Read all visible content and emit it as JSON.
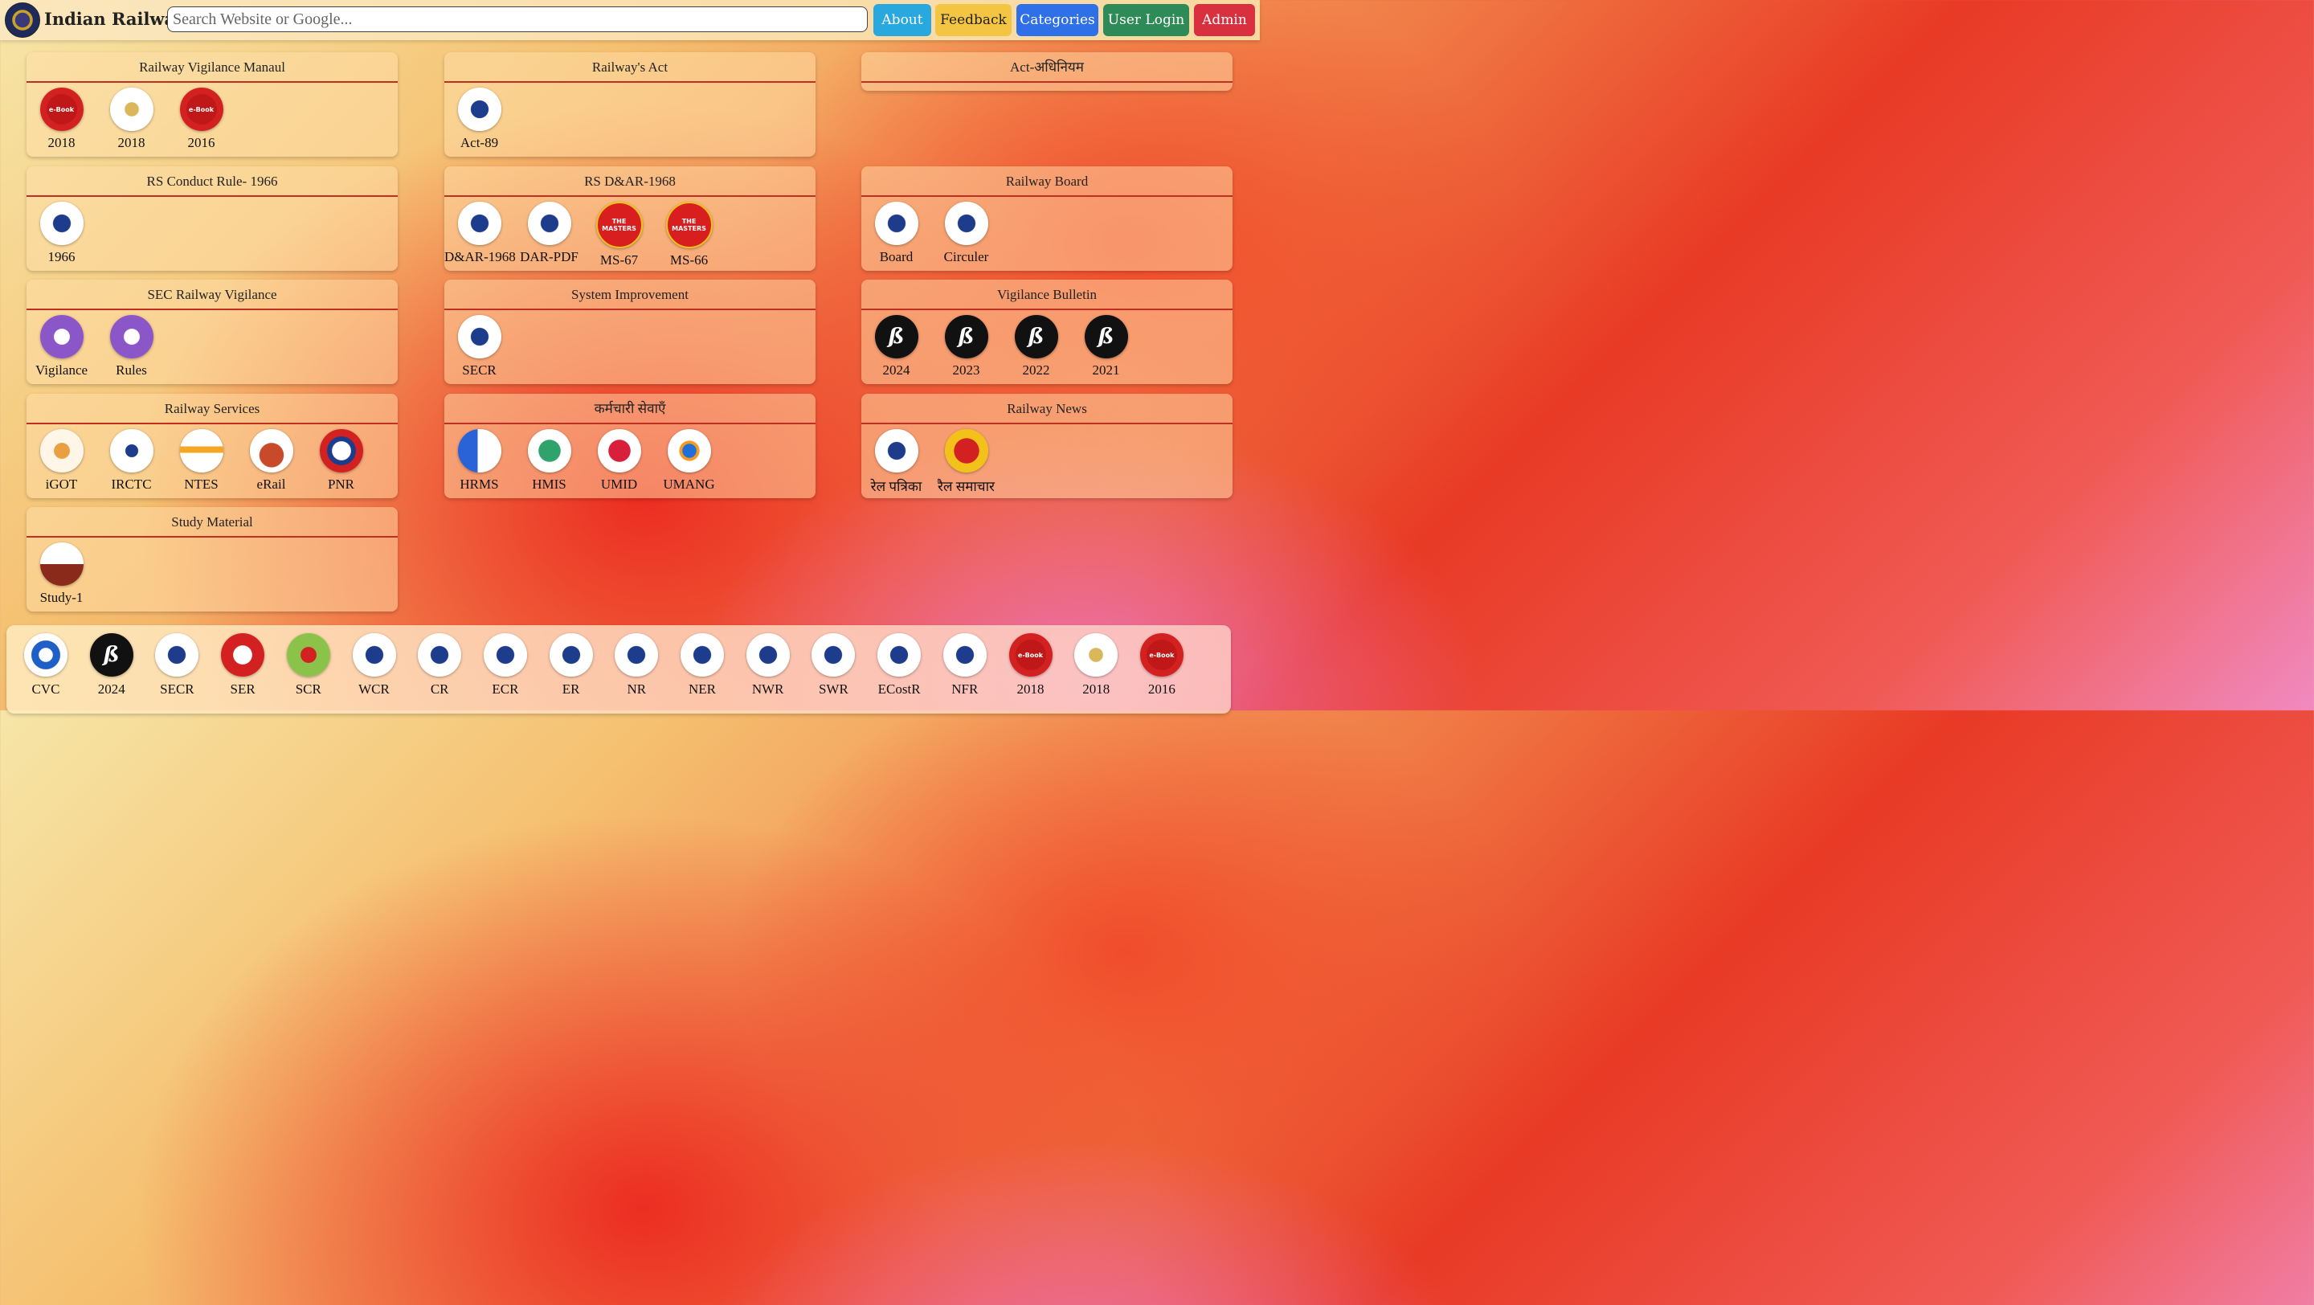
{
  "header": {
    "brand": "Indian Railway",
    "search_placeholder": "Search Website or Google...",
    "buttons": [
      {
        "label": "About",
        "color": "#29a8e0"
      },
      {
        "label": "Feedback",
        "color": "#f4c542"
      },
      {
        "label": "Categories",
        "color": "#2f6fe8"
      },
      {
        "label": "User Login",
        "color": "#2e8b57"
      },
      {
        "label": "Admin",
        "color": "#d9303f"
      }
    ]
  },
  "cards": [
    {
      "title": "Railway Vigilance Manaul",
      "items": [
        {
          "label": "2018",
          "icon": "ebook-icon"
        },
        {
          "label": "2018",
          "icon": "emblem-icon"
        },
        {
          "label": "2016",
          "icon": "ebook-icon"
        }
      ]
    },
    {
      "title": "Railway's Act",
      "items": [
        {
          "label": "Act-89",
          "icon": "act-book-icon"
        }
      ]
    },
    {
      "title": "Act-अधिनियम",
      "items": []
    },
    {
      "title": "RS Conduct Rule- 1966",
      "items": [
        {
          "label": "1966",
          "icon": "conduct-rule-icon"
        }
      ]
    },
    {
      "title": "RS D&AR-1968",
      "items": [
        {
          "label": "D&AR-1968",
          "icon": "dar-book-icon"
        },
        {
          "label": "DAR-PDF",
          "icon": "dar-book-icon"
        },
        {
          "label": "MS-67",
          "icon": "masters-icon"
        },
        {
          "label": "MS-66",
          "icon": "masters-icon"
        }
      ]
    },
    {
      "title": "Railway Board",
      "items": [
        {
          "label": "Board",
          "icon": "ministry-icon"
        },
        {
          "label": "Circuler",
          "icon": "circulars-icon"
        }
      ]
    },
    {
      "title": "SEC Railway Vigilance",
      "items": [
        {
          "label": "Vigilance",
          "icon": "secr-vigilance-icon"
        },
        {
          "label": "Rules",
          "icon": "secr-rules-icon"
        }
      ]
    },
    {
      "title": "System Improvement",
      "items": [
        {
          "label": "SECR",
          "icon": "brain-gears-icon"
        }
      ]
    },
    {
      "title": "Vigilance Bulletin",
      "items": [
        {
          "label": "2024",
          "icon": "bulletin-icon"
        },
        {
          "label": "2023",
          "icon": "bulletin-icon"
        },
        {
          "label": "2022",
          "icon": "bulletin-icon"
        },
        {
          "label": "2021",
          "icon": "bulletin-icon"
        }
      ]
    },
    {
      "title": "Railway Services",
      "items": [
        {
          "label": "iGOT",
          "icon": "igot-icon"
        },
        {
          "label": "IRCTC",
          "icon": "irctc-icon"
        },
        {
          "label": "NTES",
          "icon": "ntes-icon"
        },
        {
          "label": "eRail",
          "icon": "train-icon"
        },
        {
          "label": "PNR",
          "icon": "pnr-status-icon"
        }
      ]
    },
    {
      "title": "कर्मचारी सेवाएँ",
      "items": [
        {
          "label": "HRMS",
          "icon": "hrms-icon"
        },
        {
          "label": "HMIS",
          "icon": "hmis-icon"
        },
        {
          "label": "UMID",
          "icon": "umid-icon"
        },
        {
          "label": "UMANG",
          "icon": "umang-icon"
        }
      ]
    },
    {
      "title": "Railway News",
      "items": [
        {
          "label": "रेल पत्रिका",
          "icon": "rail-patrika-icon"
        },
        {
          "label": "रैल समाचार",
          "icon": "rail-samachar-icon"
        }
      ]
    },
    {
      "title": "Study Material",
      "items": [
        {
          "label": "Study-1",
          "icon": "study-material-icon"
        }
      ]
    }
  ],
  "bottom_bar": [
    {
      "label": "CVC",
      "icon": "cvc-icon"
    },
    {
      "label": "2024",
      "icon": "bulletin-icon"
    },
    {
      "label": "SECR",
      "icon": "secr-icon"
    },
    {
      "label": "SER",
      "icon": "ser-icon"
    },
    {
      "label": "SCR",
      "icon": "scr-icon"
    },
    {
      "label": "WCR",
      "icon": "wcr-icon"
    },
    {
      "label": "CR",
      "icon": "cr-icon"
    },
    {
      "label": "ECR",
      "icon": "ecr-icon"
    },
    {
      "label": "ER",
      "icon": "er-icon"
    },
    {
      "label": "NR",
      "icon": "nr-icon"
    },
    {
      "label": "NER",
      "icon": "ner-icon"
    },
    {
      "label": "NWR",
      "icon": "nwr-icon"
    },
    {
      "label": "SWR",
      "icon": "swr-icon"
    },
    {
      "label": "ECostR",
      "icon": "ecor-icon"
    },
    {
      "label": "NFR",
      "icon": "nfr-icon"
    },
    {
      "label": "2018",
      "icon": "ebook-icon"
    },
    {
      "label": "2018",
      "icon": "emblem-icon"
    },
    {
      "label": "2016",
      "icon": "ebook-icon"
    }
  ]
}
